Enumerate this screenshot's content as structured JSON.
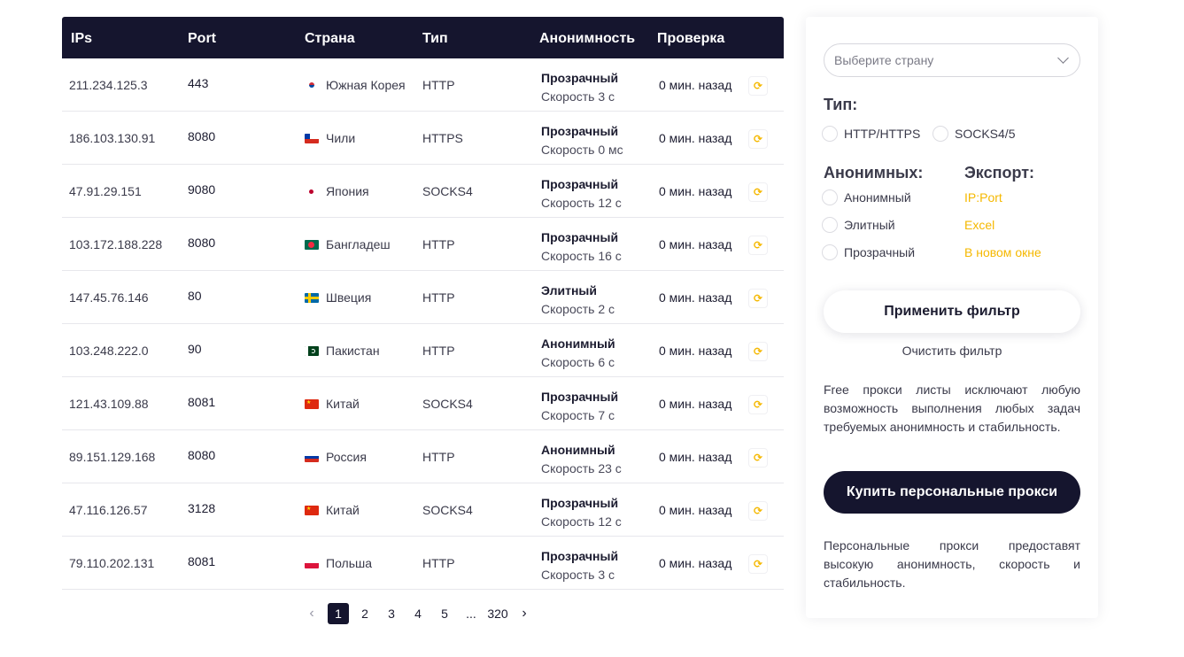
{
  "table": {
    "headers": [
      "IPs",
      "Port",
      "Страна",
      "Тип",
      "Анонимность",
      "Проверка"
    ],
    "rows": [
      {
        "ip": "211.234.125.3",
        "port": "443",
        "country": "Южная Корея",
        "flag": "kr",
        "type": "HTTP",
        "anonymity": "Прозрачный",
        "speed": "Скорость 3 с",
        "checked": "0 мин. назад"
      },
      {
        "ip": "186.103.130.91",
        "port": "8080",
        "country": "Чили",
        "flag": "cl",
        "type": "HTTPS",
        "anonymity": "Прозрачный",
        "speed": "Скорость 0 мс",
        "checked": "0 мин. назад"
      },
      {
        "ip": "47.91.29.151",
        "port": "9080",
        "country": "Япония",
        "flag": "jp",
        "type": "SOCKS4",
        "anonymity": "Прозрачный",
        "speed": "Скорость 12 с",
        "checked": "0 мин. назад"
      },
      {
        "ip": "103.172.188.228",
        "port": "8080",
        "country": "Бангладеш",
        "flag": "bd",
        "type": "HTTP",
        "anonymity": "Прозрачный",
        "speed": "Скорость 16 с",
        "checked": "0 мин. назад"
      },
      {
        "ip": "147.45.76.146",
        "port": "80",
        "country": "Швеция",
        "flag": "se",
        "type": "HTTP",
        "anonymity": "Элитный",
        "speed": "Скорость 2 с",
        "checked": "0 мин. назад"
      },
      {
        "ip": "103.248.222.0",
        "port": "90",
        "country": "Пакистан",
        "flag": "pk",
        "type": "HTTP",
        "anonymity": "Анонимный",
        "speed": "Скорость 6 с",
        "checked": "0 мин. назад"
      },
      {
        "ip": "121.43.109.88",
        "port": "8081",
        "country": "Китай",
        "flag": "cn",
        "type": "SOCKS4",
        "anonymity": "Прозрачный",
        "speed": "Скорость 7 с",
        "checked": "0 мин. назад"
      },
      {
        "ip": "89.151.129.168",
        "port": "8080",
        "country": "Россия",
        "flag": "ru",
        "type": "HTTP",
        "anonymity": "Анонимный",
        "speed": "Скорость 23 с",
        "checked": "0 мин. назад"
      },
      {
        "ip": "47.116.126.57",
        "port": "3128",
        "country": "Китай",
        "flag": "cn",
        "type": "SOCKS4",
        "anonymity": "Прозрачный",
        "speed": "Скорость 12 с",
        "checked": "0 мин. назад"
      },
      {
        "ip": "79.110.202.131",
        "port": "8081",
        "country": "Польша",
        "flag": "pl",
        "type": "HTTP",
        "anonymity": "Прозрачный",
        "speed": "Скорость 3 с",
        "checked": "0 мин. назад"
      }
    ],
    "refresh_icon": "refresh-icon"
  },
  "pagination": {
    "prev_icon": "chevron-left-icon",
    "pages": [
      "1",
      "2",
      "3",
      "4",
      "5",
      "...",
      "320"
    ],
    "current": "1",
    "next_icon": "chevron-right-icon"
  },
  "sidebar": {
    "country_placeholder": "Выберите страну",
    "type_title": "Тип:",
    "type_options": [
      "HTTP/HTTPS",
      "SOCKS4/5"
    ],
    "anon_title": "Анонимных:",
    "anon_options": [
      "Анонимный",
      "Элитный",
      "Прозрачный"
    ],
    "export_title": "Экспорт:",
    "export_links": [
      "IP:Port",
      "Excel",
      "В новом окне"
    ],
    "apply_label": "Применить фильтр",
    "clear_label": "Очистить фильтр",
    "free_note": "Free прокси листы исключают любую возможность выполнения любых задач требуемых анонимность и стабильность.",
    "buy_label": "Купить персональные прокси",
    "personal_note": "Персональные прокси предоставят высокую анонимность, скорость и стабильность."
  },
  "colors": {
    "header_bg": "#15152e",
    "accent": "#f5b800",
    "text": "#3a3a4a"
  }
}
